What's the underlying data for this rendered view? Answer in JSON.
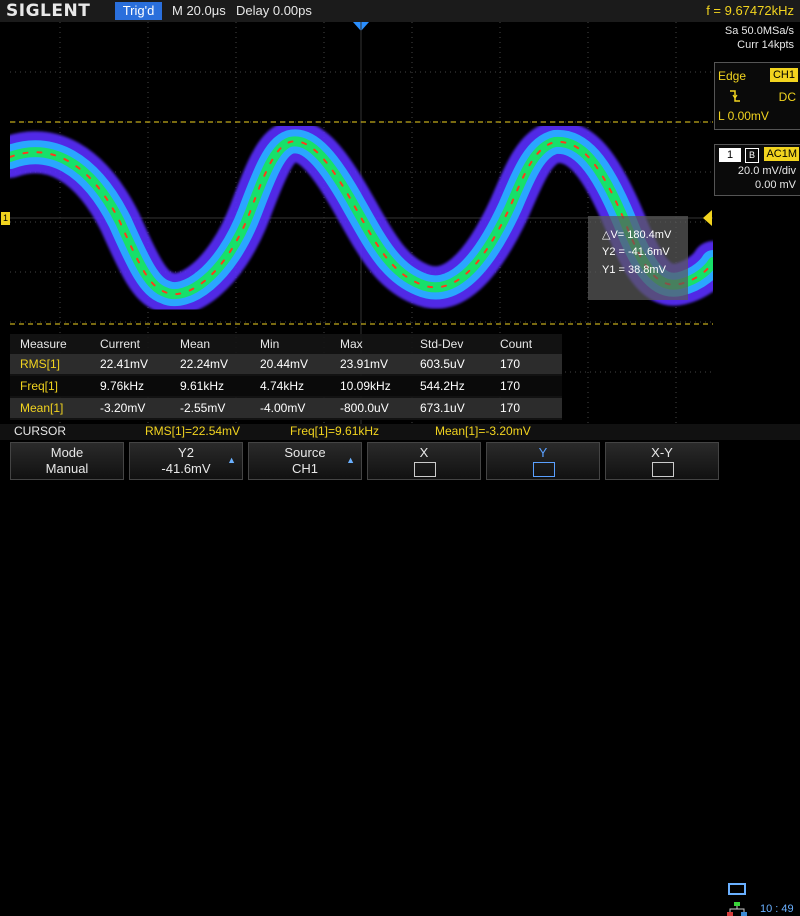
{
  "topbar": {
    "brand": "SIGLENT",
    "trigger_state": "Trig'd",
    "timebase": "M 20.0μs",
    "delay": "Delay 0.00ps",
    "frequency": "f = 9.67472kHz"
  },
  "acquisition": {
    "sample_rate": "Sa 50.0MSa/s",
    "memory": "Curr 14kpts"
  },
  "trigger_panel": {
    "type": "Edge",
    "source": "CH1",
    "slope_icon": "falling-edge-icon",
    "coupling": "DC",
    "level": "L  0.00mV"
  },
  "channel_panel": {
    "channel": "1",
    "bw_icon": "B",
    "coupling": "AC1M",
    "scale": "20.0 mV/div",
    "offset": "0.00 mV"
  },
  "left_marker": "1",
  "cursor_readout": {
    "delta": "△V= 180.4mV",
    "y2": "Y2 = -41.6mV",
    "y1": "Y1 = 38.8mV"
  },
  "measure_table": {
    "headers": [
      "Measure",
      "Current",
      "Mean",
      "Min",
      "Max",
      "Std-Dev",
      "Count"
    ],
    "rows": [
      [
        "RMS[1]",
        "22.41mV",
        "22.24mV",
        "20.44mV",
        "23.91mV",
        "603.5uV",
        "170"
      ],
      [
        "Freq[1]",
        "9.76kHz",
        "9.61kHz",
        "4.74kHz",
        "10.09kHz",
        "544.2Hz",
        "170"
      ],
      [
        "Mean[1]",
        "-3.20mV",
        "-2.55mV",
        "-4.00mV",
        "-800.0uV",
        "673.1uV",
        "170"
      ]
    ]
  },
  "statusbar": {
    "menu": "CURSOR",
    "rms": "RMS[1]=22.54mV",
    "freq": "Freq[1]=9.61kHz",
    "mean": "Mean[1]=-3.20mV"
  },
  "softkeys": [
    {
      "line1": "Mode",
      "line2": "Manual"
    },
    {
      "line1": "Y2",
      "line2": "-41.6mV"
    },
    {
      "line1": "Source",
      "line2": "CH1"
    },
    {
      "line1": "X",
      "line2": ""
    },
    {
      "line1": "Y",
      "line2": ""
    },
    {
      "line1": "X-Y",
      "line2": ""
    }
  ],
  "clock": "10 : 49",
  "colors": {
    "accent": "#2a6fdc",
    "trigger_yellow": "#f2d41f",
    "trace_outer": "#5a2dff",
    "trace_mid": "#2aa6ff",
    "trace_core": "#17e06a",
    "trace_peak": "#ff3a1a"
  }
}
